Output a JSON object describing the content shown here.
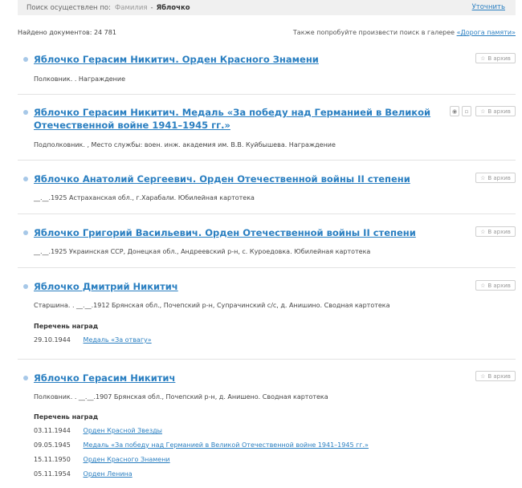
{
  "search_bar": {
    "label": "Поиск осуществлен по:",
    "criteria_field": "Фамилия",
    "criteria_separator": "-",
    "criteria_value": "Яблочко",
    "refine_link": "Уточнить"
  },
  "summary": {
    "found_label": "Найдено документов:",
    "found_count": "24 781",
    "gallery_hint": "Также попробуйте произвести поиск в галерее",
    "gallery_link": "«Дорога памяти»"
  },
  "archive_button_label": "В архив",
  "star_icon": "star-icon",
  "results": [
    {
      "title": "Яблочко Герасим Никитич. Орден Красного Знамени",
      "desc": "Полковник. . Награждение"
    },
    {
      "title_line1": "Яблочко Герасим Никитич. Медаль «За победу над Германией в Великой",
      "title_line2": "Отечественной войне 1941–1945 гг.»",
      "desc": "Подполковник. , Место службы: воен. инж. академия им. В.В. Куйбышева. Награждение",
      "icons": [
        "eye-icon",
        "document-icon"
      ]
    },
    {
      "title": "Яблочко Анатолий Сергеевич. Орден Отечественной войны II степени",
      "desc": "__.__.1925 Астраханская обл., г.Харабали. Юбилейная картотека"
    },
    {
      "title": "Яблочко Григорий Васильевич. Орден Отечественной войны II степени",
      "desc": "__.__.1925 Украинская ССР, Донецкая обл., Андреевский р-н, с. Куроедовка. Юбилейная картотека"
    },
    {
      "title": "Яблочко Дмитрий Никитич",
      "desc": "Старшина. . __.__.1912 Брянская обл., Почепский р-н, Супрачинский с/с, д. Анишино. Сводная картотека",
      "awards_label": "Перечень наград",
      "awards": [
        {
          "date": "29.10.1944",
          "name": "Медаль «За отвагу»"
        }
      ]
    },
    {
      "title": "Яблочко Герасим Никитич",
      "desc": "Полковник. . __.__.1907 Брянская обл., Почепский р-н, д. Анишено. Сводная картотека",
      "awards_label": "Перечень наград",
      "awards": [
        {
          "date": "03.11.1944",
          "name": "Орден Красной Звезды"
        },
        {
          "date": "09.05.1945",
          "name": "Медаль «За победу над Германией в Великой Отечественной войне 1941–1945 гг.»"
        },
        {
          "date": "15.11.1950",
          "name": "Орден Красного Знамени"
        },
        {
          "date": "05.11.1954",
          "name": "Орден Ленина"
        }
      ]
    }
  ]
}
